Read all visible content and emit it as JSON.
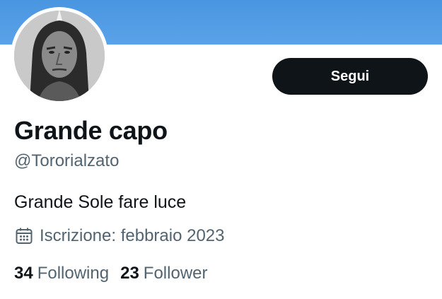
{
  "profile": {
    "display_name": "Grande capo",
    "handle": "@Tororialzato",
    "bio": "Grande Sole fare luce",
    "joined": "Iscrizione: febbraio 2023",
    "follow_label": "Segui",
    "following_count": "34",
    "following_label": "Following",
    "followers_count": "23",
    "followers_label": "Follower"
  },
  "icons": {
    "calendar": "calendar-icon"
  },
  "colors": {
    "banner": "#4a95e0",
    "button_bg": "#0f1419",
    "secondary_text": "#536471"
  }
}
